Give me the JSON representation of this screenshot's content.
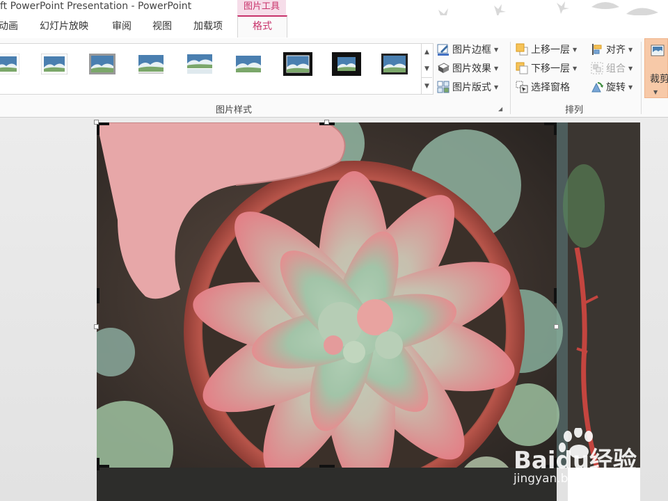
{
  "window": {
    "title": "ft PowerPoint Presentation - PowerPoint",
    "context_tab_label": "图片工具"
  },
  "tabs": [
    {
      "label": "动画"
    },
    {
      "label": "幻灯片放映"
    },
    {
      "label": "审阅"
    },
    {
      "label": "视图"
    },
    {
      "label": "加载项"
    },
    {
      "label": "格式",
      "active": true
    }
  ],
  "ribbon": {
    "picture_styles": {
      "group_label": "图片样式",
      "border_label": "图片边框",
      "effects_label": "图片效果",
      "layout_label": "图片版式"
    },
    "arrange": {
      "group_label": "排列",
      "bring_forward_label": "上移一层",
      "send_backward_label": "下移一层",
      "selection_pane_label": "选择窗格",
      "align_label": "对齐",
      "group_btn_label": "组合",
      "rotate_label": "旋转"
    },
    "size": {
      "crop_label": "裁剪"
    }
  },
  "watermark": {
    "brand": "Baidu经验",
    "url": "jingyan.baidu.com"
  },
  "colors": {
    "accent": "#c8336b",
    "context_tab_bg": "#f6dde9",
    "crop_highlight": "#f7c9a8"
  }
}
